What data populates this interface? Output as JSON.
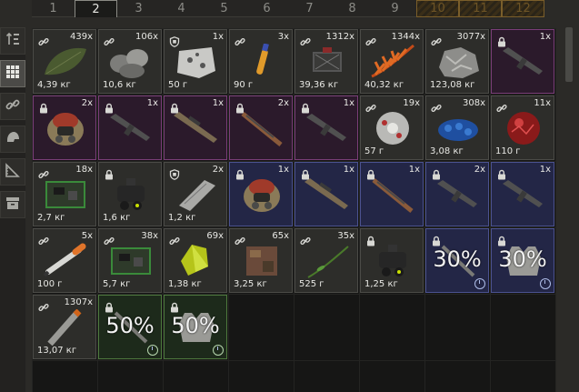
{
  "tabs": [
    {
      "label": "1",
      "state": "normal"
    },
    {
      "label": "2",
      "state": "active"
    },
    {
      "label": "3",
      "state": "normal"
    },
    {
      "label": "4",
      "state": "normal"
    },
    {
      "label": "5",
      "state": "normal"
    },
    {
      "label": "6",
      "state": "normal"
    },
    {
      "label": "7",
      "state": "normal"
    },
    {
      "label": "8",
      "state": "normal"
    },
    {
      "label": "9",
      "state": "normal"
    },
    {
      "label": "10",
      "state": "locked"
    },
    {
      "label": "11",
      "state": "locked"
    },
    {
      "label": "12",
      "state": "locked"
    }
  ],
  "sidebar": [
    {
      "icon": "sort-icon",
      "active": false
    },
    {
      "icon": "grid-view-icon",
      "active": true
    },
    {
      "icon": "link-icon",
      "active": false
    },
    {
      "icon": "helmet-icon",
      "active": false
    },
    {
      "icon": "ruler-icon",
      "active": false
    },
    {
      "icon": "archive-icon",
      "active": false
    }
  ],
  "colors": {
    "blue": "#4b5290",
    "purple": "#7a3e78",
    "green": "#4e7a3e",
    "orange_art": "#e09a2a"
  },
  "slots": [
    {
      "row": 0,
      "col": 0,
      "count": "439x",
      "weight": "4,39 кг",
      "icon": "link-icon",
      "item": "leaf-icon",
      "rarity": "none"
    },
    {
      "row": 0,
      "col": 1,
      "count": "106x",
      "weight": "10,6 кг",
      "icon": "link-icon",
      "item": "rocks-icon",
      "rarity": "none"
    },
    {
      "row": 0,
      "col": 2,
      "count": "1x",
      "weight": "50 г",
      "icon": "shield-icon",
      "item": "metal-scrap-icon",
      "rarity": "none"
    },
    {
      "row": 0,
      "col": 3,
      "count": "3x",
      "weight": "90 г",
      "icon": "link-icon",
      "item": "stimulant-tube-icon",
      "rarity": "none"
    },
    {
      "row": 0,
      "col": 4,
      "count": "1312x",
      "weight": "39,36 кг",
      "icon": "link-icon",
      "item": "wire-icon",
      "rarity": "none"
    },
    {
      "row": 0,
      "col": 5,
      "count": "1344x",
      "weight": "40,32 кг",
      "icon": "link-icon",
      "item": "orange-fern-icon",
      "rarity": "none"
    },
    {
      "row": 0,
      "col": 6,
      "count": "3077x",
      "weight": "123,08 кг",
      "icon": "link-icon",
      "item": "ore-icon",
      "rarity": "none"
    },
    {
      "row": 0,
      "col": 7,
      "count": "1x",
      "weight": "",
      "icon": "lock-icon",
      "item": "rifle-icon",
      "rarity": "purple"
    },
    {
      "row": 1,
      "col": 0,
      "count": "2x",
      "weight": "",
      "icon": "lock-icon",
      "item": "hazmat-helmet-icon",
      "rarity": "purple"
    },
    {
      "row": 1,
      "col": 1,
      "count": "1x",
      "weight": "",
      "icon": "lock-icon",
      "item": "rifle-icon",
      "rarity": "purple"
    },
    {
      "row": 1,
      "col": 2,
      "count": "1x",
      "weight": "",
      "icon": "lock-icon",
      "item": "sniper-rifle-icon",
      "rarity": "purple"
    },
    {
      "row": 1,
      "col": 3,
      "count": "2x",
      "weight": "",
      "icon": "lock-icon",
      "item": "shotgun-icon",
      "rarity": "purple"
    },
    {
      "row": 1,
      "col": 4,
      "count": "1x",
      "weight": "",
      "icon": "lock-icon",
      "item": "rifle-icon",
      "rarity": "purple"
    },
    {
      "row": 1,
      "col": 5,
      "count": "19x",
      "weight": "57 г",
      "icon": "link-icon",
      "item": "disc-icon",
      "rarity": "none"
    },
    {
      "row": 1,
      "col": 6,
      "count": "308x",
      "weight": "3,08 кг",
      "icon": "link-icon",
      "item": "blue-crystals-icon",
      "rarity": "none"
    },
    {
      "row": 1,
      "col": 7,
      "count": "11x",
      "weight": "110 г",
      "icon": "link-icon",
      "item": "red-orb-icon",
      "rarity": "none"
    },
    {
      "row": 2,
      "col": 0,
      "count": "18x",
      "weight": "2,7 кг",
      "icon": "link-icon",
      "item": "circuit-board-icon",
      "rarity": "none"
    },
    {
      "row": 2,
      "col": 1,
      "count": "",
      "weight": "1,6 кг",
      "icon": "lock-icon",
      "item": "night-vision-icon",
      "rarity": "none"
    },
    {
      "row": 2,
      "col": 2,
      "count": "2x",
      "weight": "1,2 кг",
      "icon": "shield-icon",
      "item": "armor-plate-icon",
      "rarity": "none"
    },
    {
      "row": 2,
      "col": 3,
      "count": "1x",
      "weight": "",
      "icon": "lock-icon",
      "item": "hazmat-helmet-icon",
      "rarity": "blue"
    },
    {
      "row": 2,
      "col": 4,
      "count": "1x",
      "weight": "",
      "icon": "lock-icon",
      "item": "sniper-rifle-icon",
      "rarity": "blue"
    },
    {
      "row": 2,
      "col": 5,
      "count": "1x",
      "weight": "",
      "icon": "lock-icon",
      "item": "shotgun-icon",
      "rarity": "blue"
    },
    {
      "row": 2,
      "col": 6,
      "count": "2x",
      "weight": "",
      "icon": "lock-icon",
      "item": "rifle-icon",
      "rarity": "blue"
    },
    {
      "row": 2,
      "col": 7,
      "count": "1x",
      "weight": "",
      "icon": "lock-icon",
      "item": "rifle-icon",
      "rarity": "blue"
    },
    {
      "row": 3,
      "col": 0,
      "count": "5x",
      "weight": "100 г",
      "icon": "link-icon",
      "item": "stim-injector-icon",
      "rarity": "none"
    },
    {
      "row": 3,
      "col": 1,
      "count": "38x",
      "weight": "5,7 кг",
      "icon": "link-icon",
      "item": "circuit-board-icon",
      "rarity": "none"
    },
    {
      "row": 3,
      "col": 2,
      "count": "69x",
      "weight": "1,38 кг",
      "icon": "link-icon",
      "item": "yellow-crystal-icon",
      "rarity": "none"
    },
    {
      "row": 3,
      "col": 3,
      "count": "65x",
      "weight": "3,25 кг",
      "icon": "link-icon",
      "item": "rusty-box-icon",
      "rarity": "none"
    },
    {
      "row": 3,
      "col": 4,
      "count": "35x",
      "weight": "525 г",
      "icon": "link-icon",
      "item": "plant-stem-icon",
      "rarity": "none"
    },
    {
      "row": 3,
      "col": 5,
      "count": "",
      "weight": "1,25 кг",
      "icon": "lock-icon",
      "item": "night-vision-icon",
      "rarity": "none"
    },
    {
      "row": 3,
      "col": 6,
      "count": "",
      "weight": "",
      "icon": "lock-icon",
      "item": "upgrade-30",
      "rarity": "blue",
      "percent": "30%"
    },
    {
      "row": 3,
      "col": 7,
      "count": "",
      "weight": "",
      "icon": "lock-icon",
      "item": "vest-upgrade-30",
      "rarity": "blue",
      "percent": "30%"
    },
    {
      "row": 4,
      "col": 0,
      "count": "1307x",
      "weight": "13,07 кг",
      "icon": "link-icon",
      "item": "pipe-icon",
      "rarity": "none"
    },
    {
      "row": 4,
      "col": 1,
      "count": "",
      "weight": "",
      "icon": "lock-icon",
      "item": "upgrade-50",
      "rarity": "green",
      "percent": "50%"
    },
    {
      "row": 4,
      "col": 2,
      "count": "",
      "weight": "",
      "icon": "lock-icon",
      "item": "vest-upgrade-50",
      "rarity": "green",
      "percent": "50%"
    }
  ]
}
